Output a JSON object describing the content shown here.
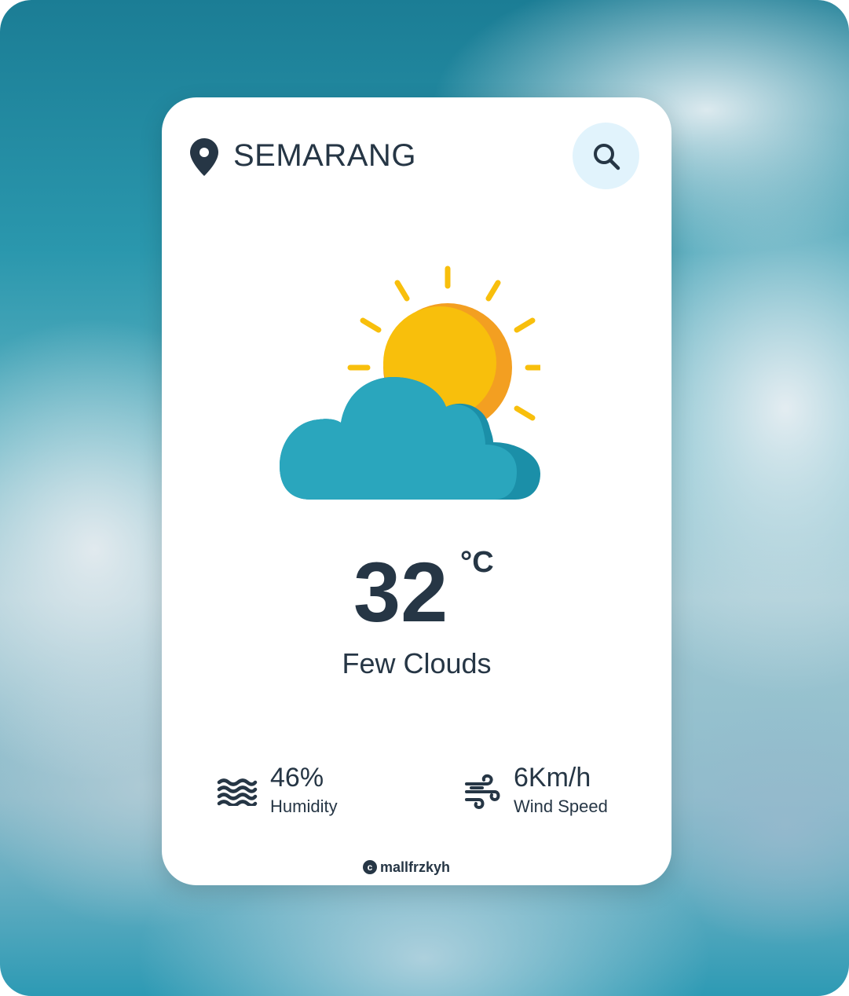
{
  "location": {
    "city": "SEMARANG",
    "icon": "map-pin-icon"
  },
  "search": {
    "icon": "search-icon"
  },
  "weather": {
    "icon": "sun-behind-cloud-icon",
    "temperature": "32",
    "unit": "°C",
    "description": "Few Clouds"
  },
  "details": {
    "humidity": {
      "value": "46%",
      "label": "Humidity",
      "icon": "water-waves-icon"
    },
    "wind": {
      "value": "6Km/h",
      "label": "Wind Speed",
      "icon": "wind-icon"
    }
  },
  "footer": {
    "copyright_symbol": "c",
    "author": "mallfrzkyh"
  },
  "colors": {
    "text": "#263645",
    "search_bg": "#e1f3fc",
    "sun": "#f8bf0c",
    "sun_shade": "#f39f21",
    "cloud": "#2aa6bd",
    "cloud_shade": "#1b8fa8"
  }
}
